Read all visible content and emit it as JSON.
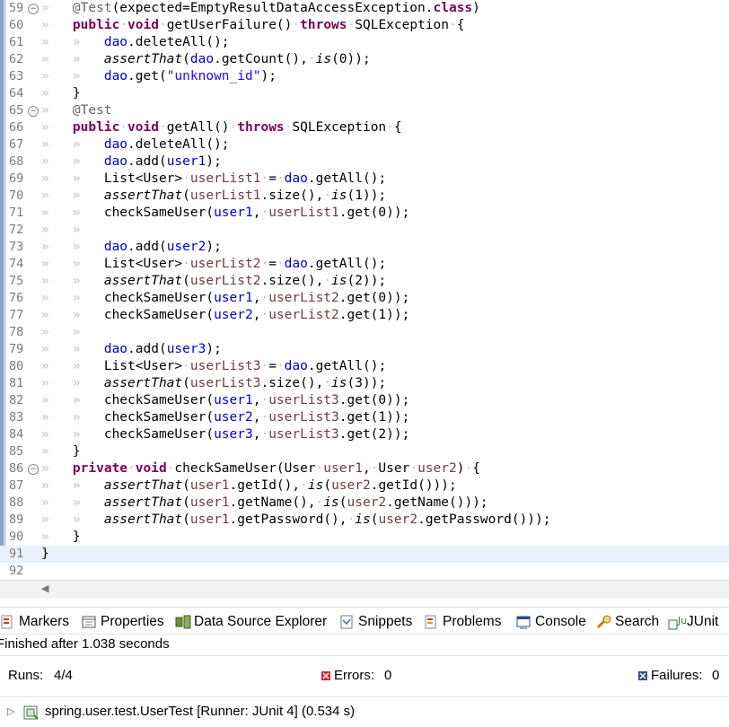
{
  "editor": {
    "lines": [
      {
        "num": "59",
        "fold": "−",
        "hl": false,
        "tokens": [
          [
            "ws",
            "»   "
          ],
          [
            "ann",
            "@Test"
          ],
          [
            "plain",
            "(expected=EmptyResultDataAccessException."
          ],
          [
            "kw",
            "class"
          ],
          [
            "plain",
            ")"
          ]
        ]
      },
      {
        "num": "60",
        "fold": "",
        "hl": false,
        "tokens": [
          [
            "ws",
            "»   "
          ],
          [
            "kw",
            "public"
          ],
          [
            "ws",
            "·"
          ],
          [
            "kw",
            "void"
          ],
          [
            "ws",
            "·"
          ],
          [
            "plain",
            "getUserFailure()"
          ],
          [
            "ws",
            "·"
          ],
          [
            "kw",
            "throws"
          ],
          [
            "ws",
            "·"
          ],
          [
            "plain",
            "SQLException"
          ],
          [
            "ws",
            "·"
          ],
          [
            "plain",
            "{"
          ]
        ]
      },
      {
        "num": "61",
        "fold": "",
        "hl": false,
        "tokens": [
          [
            "ws",
            "»   »   "
          ],
          [
            "field",
            "dao"
          ],
          [
            "plain",
            ".deleteAll();"
          ]
        ]
      },
      {
        "num": "62",
        "fold": "",
        "hl": false,
        "tokens": [
          [
            "ws",
            "»   »   "
          ],
          [
            "static",
            "assertThat"
          ],
          [
            "plain",
            "("
          ],
          [
            "field",
            "dao"
          ],
          [
            "plain",
            ".getCount(),"
          ],
          [
            "ws",
            "·"
          ],
          [
            "static",
            "is"
          ],
          [
            "plain",
            "(0));"
          ]
        ]
      },
      {
        "num": "63",
        "fold": "",
        "hl": false,
        "tokens": [
          [
            "ws",
            "»   »   "
          ],
          [
            "field",
            "dao"
          ],
          [
            "plain",
            ".get("
          ],
          [
            "str",
            "\"unknown_id\""
          ],
          [
            "plain",
            ");"
          ]
        ]
      },
      {
        "num": "64",
        "fold": "",
        "hl": false,
        "tokens": [
          [
            "ws",
            "»   "
          ],
          [
            "plain",
            "}"
          ]
        ]
      },
      {
        "num": "65",
        "fold": "−",
        "hl": false,
        "tokens": [
          [
            "ws",
            "»   "
          ],
          [
            "ann",
            "@Test"
          ]
        ]
      },
      {
        "num": "66",
        "fold": "",
        "hl": false,
        "tokens": [
          [
            "ws",
            "»   "
          ],
          [
            "kw",
            "public"
          ],
          [
            "ws",
            "·"
          ],
          [
            "kw",
            "void"
          ],
          [
            "ws",
            "·"
          ],
          [
            "plain",
            "getAll()"
          ],
          [
            "ws",
            "·"
          ],
          [
            "kw",
            "throws"
          ],
          [
            "ws",
            "·"
          ],
          [
            "plain",
            "SQLException"
          ],
          [
            "ws",
            "·"
          ],
          [
            "plain",
            "{"
          ]
        ]
      },
      {
        "num": "67",
        "fold": "",
        "hl": false,
        "tokens": [
          [
            "ws",
            "»   »   "
          ],
          [
            "field",
            "dao"
          ],
          [
            "plain",
            ".deleteAll();"
          ]
        ]
      },
      {
        "num": "68",
        "fold": "",
        "hl": false,
        "tokens": [
          [
            "ws",
            "»   »   "
          ],
          [
            "field",
            "dao"
          ],
          [
            "plain",
            ".add("
          ],
          [
            "field",
            "user1"
          ],
          [
            "plain",
            ");"
          ]
        ]
      },
      {
        "num": "69",
        "fold": "",
        "hl": false,
        "tokens": [
          [
            "ws",
            "»   »   "
          ],
          [
            "plain",
            "List<User>"
          ],
          [
            "ws",
            "·"
          ],
          [
            "local",
            "userList1"
          ],
          [
            "ws",
            "·"
          ],
          [
            "plain",
            "="
          ],
          [
            "ws",
            "·"
          ],
          [
            "field",
            "dao"
          ],
          [
            "plain",
            ".getAll();"
          ]
        ]
      },
      {
        "num": "70",
        "fold": "",
        "hl": false,
        "tokens": [
          [
            "ws",
            "»   »   "
          ],
          [
            "static",
            "assertThat"
          ],
          [
            "plain",
            "("
          ],
          [
            "local",
            "userList1"
          ],
          [
            "plain",
            ".size(),"
          ],
          [
            "ws",
            "·"
          ],
          [
            "static",
            "is"
          ],
          [
            "plain",
            "(1));"
          ]
        ]
      },
      {
        "num": "71",
        "fold": "",
        "hl": false,
        "tokens": [
          [
            "ws",
            "»   »   "
          ],
          [
            "plain",
            "checkSameUser("
          ],
          [
            "field",
            "user1"
          ],
          [
            "plain",
            ","
          ],
          [
            "ws",
            "·"
          ],
          [
            "local",
            "userList1"
          ],
          [
            "plain",
            ".get(0));"
          ]
        ]
      },
      {
        "num": "72",
        "fold": "",
        "hl": false,
        "tokens": [
          [
            "ws",
            "»   »   "
          ]
        ]
      },
      {
        "num": "73",
        "fold": "",
        "hl": false,
        "tokens": [
          [
            "ws",
            "»   »   "
          ],
          [
            "field",
            "dao"
          ],
          [
            "plain",
            ".add("
          ],
          [
            "field",
            "user2"
          ],
          [
            "plain",
            ");"
          ]
        ]
      },
      {
        "num": "74",
        "fold": "",
        "hl": false,
        "tokens": [
          [
            "ws",
            "»   »   "
          ],
          [
            "plain",
            "List<User>"
          ],
          [
            "ws",
            "·"
          ],
          [
            "local",
            "userList2"
          ],
          [
            "ws",
            "·"
          ],
          [
            "plain",
            "="
          ],
          [
            "ws",
            "·"
          ],
          [
            "field",
            "dao"
          ],
          [
            "plain",
            ".getAll();"
          ]
        ]
      },
      {
        "num": "75",
        "fold": "",
        "hl": false,
        "tokens": [
          [
            "ws",
            "»   »   "
          ],
          [
            "static",
            "assertThat"
          ],
          [
            "plain",
            "("
          ],
          [
            "local",
            "userList2"
          ],
          [
            "plain",
            ".size(),"
          ],
          [
            "ws",
            "·"
          ],
          [
            "static",
            "is"
          ],
          [
            "plain",
            "(2));"
          ]
        ]
      },
      {
        "num": "76",
        "fold": "",
        "hl": false,
        "tokens": [
          [
            "ws",
            "»   »   "
          ],
          [
            "plain",
            "checkSameUser("
          ],
          [
            "field",
            "user1"
          ],
          [
            "plain",
            ","
          ],
          [
            "ws",
            "·"
          ],
          [
            "local",
            "userList2"
          ],
          [
            "plain",
            ".get(0));"
          ]
        ]
      },
      {
        "num": "77",
        "fold": "",
        "hl": false,
        "tokens": [
          [
            "ws",
            "»   »   "
          ],
          [
            "plain",
            "checkSameUser("
          ],
          [
            "field",
            "user2"
          ],
          [
            "plain",
            ","
          ],
          [
            "ws",
            "·"
          ],
          [
            "local",
            "userList2"
          ],
          [
            "plain",
            ".get(1));"
          ]
        ]
      },
      {
        "num": "78",
        "fold": "",
        "hl": false,
        "tokens": [
          [
            "ws",
            "»   »   "
          ]
        ]
      },
      {
        "num": "79",
        "fold": "",
        "hl": false,
        "tokens": [
          [
            "ws",
            "»   »   "
          ],
          [
            "field",
            "dao"
          ],
          [
            "plain",
            ".add("
          ],
          [
            "field",
            "user3"
          ],
          [
            "plain",
            ");"
          ]
        ]
      },
      {
        "num": "80",
        "fold": "",
        "hl": false,
        "tokens": [
          [
            "ws",
            "»   »   "
          ],
          [
            "plain",
            "List<User>"
          ],
          [
            "ws",
            "·"
          ],
          [
            "local",
            "userList3"
          ],
          [
            "ws",
            "·"
          ],
          [
            "plain",
            "="
          ],
          [
            "ws",
            "·"
          ],
          [
            "field",
            "dao"
          ],
          [
            "plain",
            ".getAll();"
          ]
        ]
      },
      {
        "num": "81",
        "fold": "",
        "hl": false,
        "tokens": [
          [
            "ws",
            "»   »   "
          ],
          [
            "static",
            "assertThat"
          ],
          [
            "plain",
            "("
          ],
          [
            "local",
            "userList3"
          ],
          [
            "plain",
            ".size(),"
          ],
          [
            "ws",
            "·"
          ],
          [
            "static",
            "is"
          ],
          [
            "plain",
            "(3));"
          ]
        ]
      },
      {
        "num": "82",
        "fold": "",
        "hl": false,
        "tokens": [
          [
            "ws",
            "»   »   "
          ],
          [
            "plain",
            "checkSameUser("
          ],
          [
            "field",
            "user1"
          ],
          [
            "plain",
            ","
          ],
          [
            "ws",
            "·"
          ],
          [
            "local",
            "userList3"
          ],
          [
            "plain",
            ".get(0));"
          ]
        ]
      },
      {
        "num": "83",
        "fold": "",
        "hl": false,
        "tokens": [
          [
            "ws",
            "»   »   "
          ],
          [
            "plain",
            "checkSameUser("
          ],
          [
            "field",
            "user2"
          ],
          [
            "plain",
            ","
          ],
          [
            "ws",
            "·"
          ],
          [
            "local",
            "userList3"
          ],
          [
            "plain",
            ".get(1));"
          ]
        ]
      },
      {
        "num": "84",
        "fold": "",
        "hl": false,
        "tokens": [
          [
            "ws",
            "»   »   "
          ],
          [
            "plain",
            "checkSameUser("
          ],
          [
            "field",
            "user3"
          ],
          [
            "plain",
            ","
          ],
          [
            "ws",
            "·"
          ],
          [
            "local",
            "userList3"
          ],
          [
            "plain",
            ".get(2));"
          ]
        ]
      },
      {
        "num": "85",
        "fold": "",
        "hl": false,
        "tokens": [
          [
            "ws",
            "»   "
          ],
          [
            "plain",
            "}"
          ]
        ]
      },
      {
        "num": "86",
        "fold": "−",
        "hl": false,
        "tokens": [
          [
            "ws",
            "»   "
          ],
          [
            "kw",
            "private"
          ],
          [
            "ws",
            "·"
          ],
          [
            "kw",
            "void"
          ],
          [
            "ws",
            "·"
          ],
          [
            "plain",
            "checkSameUser(User"
          ],
          [
            "ws",
            "·"
          ],
          [
            "local",
            "user1"
          ],
          [
            "plain",
            ","
          ],
          [
            "ws",
            "·"
          ],
          [
            "plain",
            "User"
          ],
          [
            "ws",
            "·"
          ],
          [
            "local",
            "user2"
          ],
          [
            "plain",
            ")"
          ],
          [
            "ws",
            "·"
          ],
          [
            "plain",
            "{"
          ]
        ]
      },
      {
        "num": "87",
        "fold": "",
        "hl": false,
        "tokens": [
          [
            "ws",
            "»   »   "
          ],
          [
            "static",
            "assertThat"
          ],
          [
            "plain",
            "("
          ],
          [
            "local",
            "user1"
          ],
          [
            "plain",
            ".getId(),"
          ],
          [
            "ws",
            "·"
          ],
          [
            "static",
            "is"
          ],
          [
            "plain",
            "("
          ],
          [
            "local",
            "user2"
          ],
          [
            "plain",
            ".getId()));"
          ]
        ]
      },
      {
        "num": "88",
        "fold": "",
        "hl": false,
        "tokens": [
          [
            "ws",
            "»   »   "
          ],
          [
            "static",
            "assertThat"
          ],
          [
            "plain",
            "("
          ],
          [
            "local",
            "user1"
          ],
          [
            "plain",
            ".getName(),"
          ],
          [
            "ws",
            "·"
          ],
          [
            "static",
            "is"
          ],
          [
            "plain",
            "("
          ],
          [
            "local",
            "user2"
          ],
          [
            "plain",
            ".getName()));"
          ]
        ]
      },
      {
        "num": "89",
        "fold": "",
        "hl": false,
        "tokens": [
          [
            "ws",
            "»   »   "
          ],
          [
            "static",
            "assertThat"
          ],
          [
            "plain",
            "("
          ],
          [
            "local",
            "user1"
          ],
          [
            "plain",
            ".getPassword(),"
          ],
          [
            "ws",
            "·"
          ],
          [
            "static",
            "is"
          ],
          [
            "plain",
            "("
          ],
          [
            "local",
            "user2"
          ],
          [
            "plain",
            ".getPassword()));"
          ]
        ]
      },
      {
        "num": "90",
        "fold": "",
        "hl": false,
        "tokens": [
          [
            "ws",
            "»   "
          ],
          [
            "plain",
            "}"
          ]
        ]
      },
      {
        "num": "91",
        "fold": "",
        "hl": true,
        "tokens": [
          [
            "plain",
            "}"
          ]
        ]
      },
      {
        "num": "92",
        "fold": "",
        "hl": false,
        "tokens": []
      }
    ]
  },
  "views": {
    "tabs": [
      {
        "label": "Markers",
        "icon": "markers-icon"
      },
      {
        "label": "Properties",
        "icon": "properties-icon"
      },
      {
        "label": "Data Source Explorer",
        "icon": "data-source-explorer-icon"
      },
      {
        "label": "Snippets",
        "icon": "snippets-icon"
      },
      {
        "label": "Problems",
        "icon": "problems-icon"
      },
      {
        "label": "Console",
        "icon": "console-icon"
      },
      {
        "label": "Search",
        "icon": "search-icon"
      },
      {
        "label": "JUnit",
        "icon": "junit-icon"
      }
    ]
  },
  "junit": {
    "status": "Finished after 1.038 seconds",
    "runs_label": "Runs:",
    "runs_value": "4/4",
    "errors_label": "Errors:",
    "errors_value": "0",
    "failures_label": "Failures:",
    "failures_value": "0",
    "tree_item": "spring.user.test.UserTest [Runner: JUnit 4] (0.534 s)"
  },
  "colors": {
    "keyword": "#7f0055",
    "field": "#0000c0",
    "string": "#2a00ff",
    "annotation": "#646464",
    "current_line": "#e8f2fe"
  }
}
